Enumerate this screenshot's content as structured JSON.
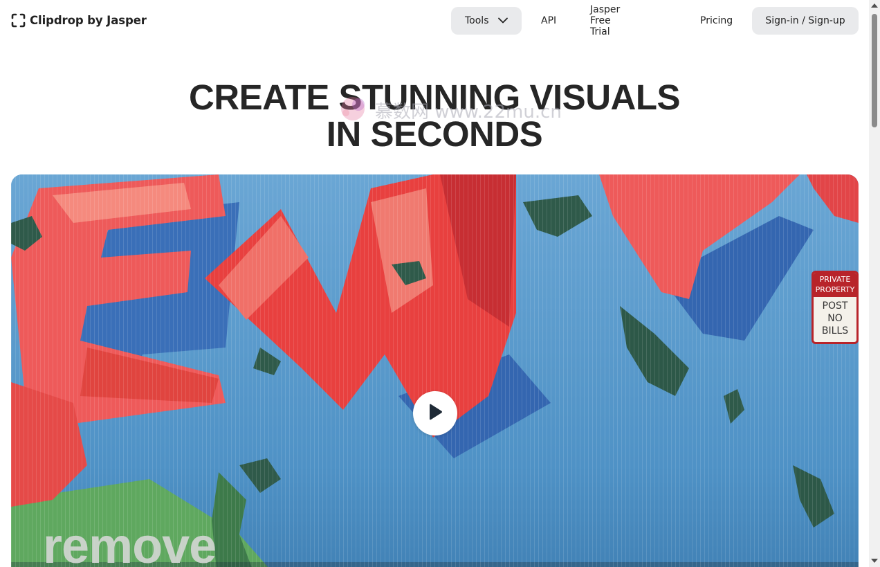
{
  "header": {
    "brand": "Clipdrop by Jasper",
    "brand_icon": "crop-frame-icon",
    "nav": {
      "tools_label": "Tools",
      "tools_icon": "chevron-down-icon",
      "api_label": "API",
      "trial_label": "Jasper Free Trial",
      "pricing_label": "Pricing",
      "signin_label": "Sign-in / Sign-up"
    }
  },
  "hero": {
    "line1": "CREATE STUNNING VISUALS",
    "line2": "IN SECONDS"
  },
  "watermark": {
    "text": "慕数网 www.22mu.cn"
  },
  "video": {
    "overlay_text": "remove",
    "play_icon": "play-icon",
    "sign": {
      "line1": "PRIVATE",
      "line2": "PROPERTY",
      "line3": "POST",
      "line4": "NO",
      "line5": "BILLS"
    }
  },
  "colors": {
    "button_bg": "#e9eaec",
    "text": "#222222",
    "heading": "#262626",
    "mural_red": "#e03a3e",
    "mural_blue": "#5a98c8"
  }
}
